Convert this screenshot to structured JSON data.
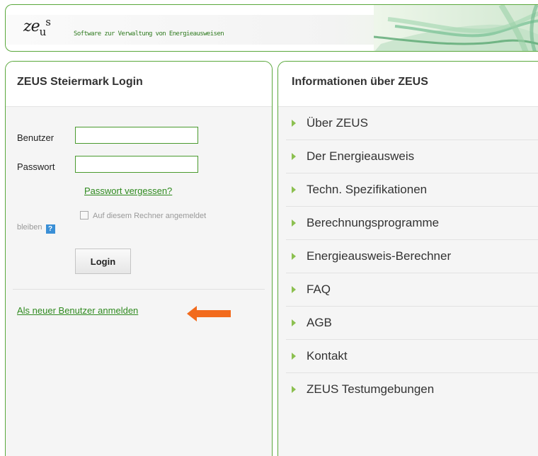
{
  "header": {
    "logo_text": "ze",
    "logo_sub": "u",
    "logo_sup": "s",
    "tagline": "Software zur Verwaltung von Energieausweisen"
  },
  "login_panel": {
    "title": "ZEUS Steiermark Login",
    "user_label": "Benutzer",
    "password_label": "Passwort",
    "user_value": "",
    "password_value": "",
    "forgot_link": "Passwort vergessen?",
    "remember_text_1": "Auf diesem Rechner angemeldet",
    "remember_text_2": "bleiben",
    "help_glyph": "?",
    "login_button": "Login",
    "register_link": "Als neuer Benutzer anmelden"
  },
  "info_panel": {
    "title": "Informationen über ZEUS",
    "items": [
      "Über ZEUS",
      "Der Energieausweis",
      "Techn. Spezifikationen",
      "Berechnungsprogramme",
      "Energieausweis-Berechner",
      "FAQ",
      "AGB",
      "Kontakt",
      "ZEUS Testumgebungen"
    ]
  },
  "colors": {
    "accent_green": "#5aa83c",
    "link_green": "#2f8a1f",
    "arrow_orange": "#f26b1d",
    "bullet_green": "#8cc050"
  }
}
